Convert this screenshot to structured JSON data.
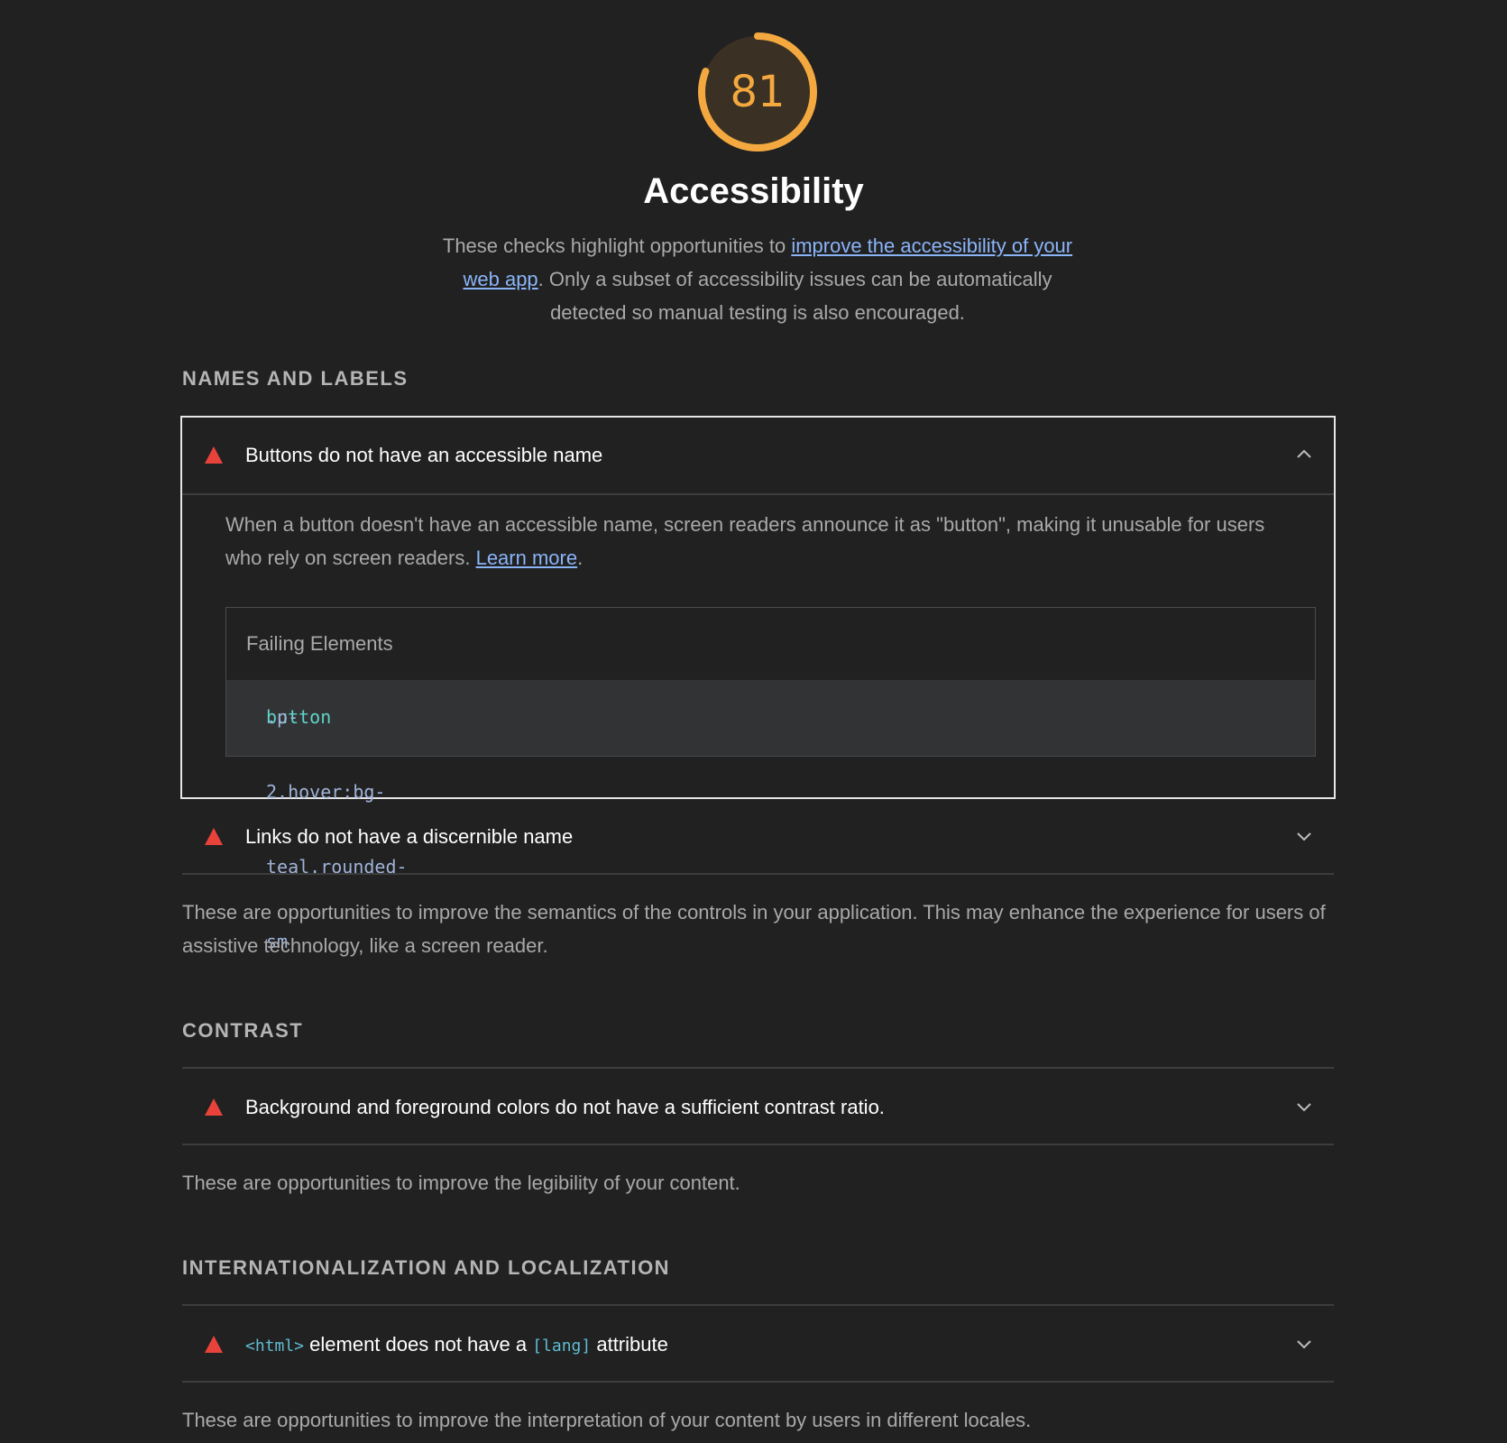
{
  "score": {
    "value": "81",
    "fraction": 0.81,
    "color": "#f4a940"
  },
  "header": {
    "title": "Accessibility",
    "intro_before": "These checks highlight opportunities to ",
    "intro_link": "improve the accessibility of your web app",
    "intro_after": ". Only a subset of accessibility issues can be automatically detected so manual testing is also encouraged."
  },
  "sections": [
    {
      "title": "NAMES AND LABELS",
      "audits": [
        {
          "label": "Buttons do not have an accessible name",
          "expanded": true,
          "description": "When a button doesn't have an accessible name, screen readers announce it as \"button\", making it unusable for users who rely on screen readers. ",
          "learn_more": "Learn more",
          "failing_title": "Failing Elements",
          "failing_tag": "button",
          "failing_classes": ".p-2.hover:bg-teal.rounded-sm"
        },
        {
          "label": "Links do not have a discernible name",
          "expanded": false
        }
      ],
      "footer": "These are opportunities to improve the semantics of the controls in your application. This may enhance the experience for users of assistive technology, like a screen reader."
    },
    {
      "title": "CONTRAST",
      "audits": [
        {
          "label": "Background and foreground colors do not have a sufficient contrast ratio.",
          "expanded": false
        }
      ],
      "footer": "These are opportunities to improve the legibility of your content."
    },
    {
      "title": "INTERNATIONALIZATION AND LOCALIZATION",
      "audits": [
        {
          "code1": "<html>",
          "text1": " element does not have a ",
          "code2": "[lang]",
          "text2": " attribute",
          "expanded": false
        }
      ],
      "footer": "These are opportunities to improve the interpretation of your content by users in different locales."
    }
  ]
}
